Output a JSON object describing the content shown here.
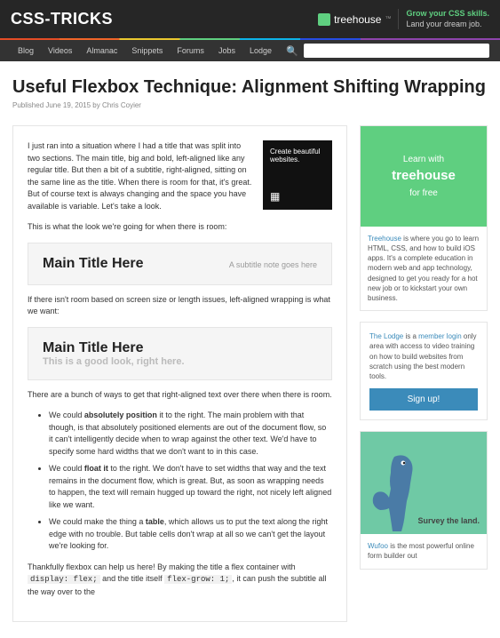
{
  "header": {
    "logo": "CSS-TRICKS",
    "treehouse": "treehouse",
    "promo1": "Grow your CSS skills.",
    "promo2": "Land your dream job."
  },
  "nav": {
    "items": [
      "Blog",
      "Videos",
      "Almanac",
      "Snippets",
      "Forums",
      "Jobs",
      "Lodge"
    ],
    "search_placeholder": ""
  },
  "article": {
    "title": "Useful Flexbox Technique: Alignment Shifting Wrapping",
    "meta": "Published June 19, 2015 by Chris Coyier",
    "intro": "I just ran into a situation where I had a title that was split into two sections. The main title, big and bold, left-aligned like any regular title. But then a bit of a subtitle, right-aligned, sitting on the same line as the title. When there is room for that, it's great. But of course text is always changing and the space you have available is variable. Let's take a look.",
    "sq_ad": "Create beautiful websites.",
    "p1": "This is what the look we're going for when there is room:",
    "ex1_title": "Main Title Here",
    "ex1_sub": "A subtitle note goes here",
    "p2": "If there isn't room based on screen size or length issues, left-aligned wrapping is what we want:",
    "ex2_title": "Main Title Here",
    "ex2_sub": "This is a good look, right here.",
    "p3": "There are a bunch of ways to get that right-aligned text over there when there is room.",
    "bullets": [
      {
        "b": "absolutely position",
        "rest": " it to the right. The main problem with that though, is that absolutely positioned elements are out of the document flow, so it can't intelligently decide when to wrap against the other text. We'd have to specify some hard widths that we don't want to in this case."
      },
      {
        "b": "float it",
        "rest": " to the right. We don't have to set widths that way and the text remains in the document flow, which is great. But, as soon as wrapping needs to happen, the text will remain hugged up toward the right, not nicely left aligned like we want."
      },
      {
        "b": "table",
        "pre": "We could make the thing a ",
        "rest": ", which allows us to put the text along the right edge with no trouble. But table cells don't wrap at all so we can't get the layout we're looking for."
      }
    ],
    "p4_pre": "Thankfully flexbox can help us here! By making the title a flex container with ",
    "p4_code1": "display: flex;",
    "p4_mid": " and the title itself ",
    "p4_code2": "flex-grow: 1;",
    "p4_post": ", it can push the subtitle all the way over to the"
  },
  "sidebar": {
    "th": {
      "l1": "Learn with",
      "l2": "treehouse",
      "l3": "for free"
    },
    "th_text": {
      "link": "Treehouse",
      "rest": " is where you go to learn HTML, CSS, and how to build iOS apps. It's a complete education in modern web and app technology, designed to get you ready for a hot new job or to kickstart your own business."
    },
    "lodge": {
      "l1": "The Lodge",
      "l2": " is a ",
      "l3": "member login",
      "l4": " only area with access to video training on how to build websites from scratch using the best modern tools."
    },
    "signup": "Sign up!",
    "survey": "Survey the land.",
    "wufoo": {
      "link": "Wufoo",
      "rest": " is the most powerful online form builder out"
    }
  }
}
